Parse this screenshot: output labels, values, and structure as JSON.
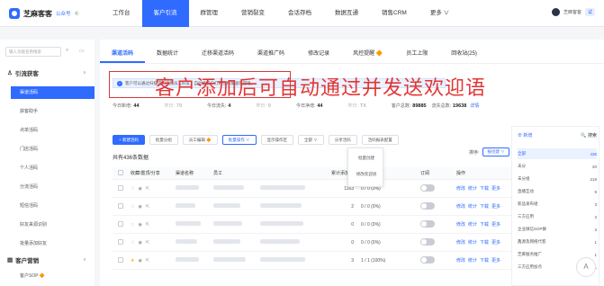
{
  "header": {
    "brand": "芝麻客客",
    "brand_sub": "公众号",
    "brand_extra": "⑥",
    "nav": [
      "工作台",
      "客户引流",
      "群管理",
      "营销裂变",
      "会话存档",
      "数据互通",
      "销售CRM",
      "更多 ∨"
    ],
    "user_name": "芝麻客客",
    "user_tag": "试"
  },
  "sidebar": {
    "search_placeholder": "输入功能名称搜索",
    "group1": "引流获客",
    "items1": [
      "渠道活码",
      "获客助手",
      "点单活码",
      "门店活码",
      "个人活码",
      "分流活码",
      "短信活码",
      "好友来源识别",
      "批量添加好友",
      "批量添加好友"
    ],
    "group2": "客户营销",
    "items2": [
      "客户SOP 🔶"
    ]
  },
  "tabs": [
    "渠道活码",
    "数据统计",
    "迁移渠道活码",
    "渠道推广码",
    "修改记录",
    "风控提醒 🔶",
    "员工上限",
    "回收站(25)"
  ],
  "notice": "客户可以通过扫描活码添加员工好友，自动给客户打标签和发送欢迎语。",
  "stats": [
    {
      "label": "今日新增:",
      "value": "44"
    },
    {
      "label": "昨日:",
      "value": "79"
    },
    {
      "label": "今日流失:",
      "value": "4"
    },
    {
      "label": "昨日:",
      "value": "9"
    },
    {
      "label": "今日净增:",
      "value": "44"
    },
    {
      "label": "昨日:",
      "value": "TX"
    }
  ],
  "stats_right": {
    "label1": "客户总数:",
    "value1": "89885",
    "label2": "流失总数:",
    "value2": "19638",
    "link": "详情"
  },
  "overlay": "客户添加后可自动通过并发送欢迎语",
  "toolbar": [
    "+ 新建活码",
    "批量分组",
    "员工编辑 🔶",
    "批量操作 ∨",
    "显示操作区",
    "全部 ∨",
    "分享活码",
    "活码报表配置"
  ],
  "dropdown": [
    "批量创建",
    "修改欢迎语"
  ],
  "count": "共有436条数据",
  "sort": {
    "label": "排序:",
    "sel1": "按创建 ∨",
    "sel2": "按人数 ∨"
  },
  "table": {
    "headers": [
      "",
      "收藏/置顶/分享",
      "渠道名称",
      "员工",
      "",
      "累计添加数",
      "新增/留存",
      "订阅",
      "操作"
    ],
    "rows": [
      {
        "count": "1163",
        "new": "0 / 0 (0%)"
      },
      {
        "count": "2",
        "new": "0 / 0 (0%)"
      },
      {
        "count": "0",
        "new": "0 / 0 (0%)"
      },
      {
        "count": "0",
        "new": "0 / 0 (0%)"
      },
      {
        "count": "3",
        "new": "1 / 1 (100%)"
      }
    ],
    "ops": [
      "修改",
      "统计",
      "下载",
      "更多"
    ]
  },
  "rpanel": {
    "title": "⊕ 新增",
    "search": "🔍 搜索",
    "items": [
      {
        "n": "全部",
        "v": "436"
      },
      {
        "n": "未分",
        "v": "20"
      },
      {
        "n": "未分组",
        "v": "219"
      },
      {
        "n": "直播互动",
        "v": "9"
      },
      {
        "n": "新品发布组",
        "v": "3"
      },
      {
        "n": "三方应用",
        "v": "3"
      },
      {
        "n": "企业微信SOP群",
        "v": "3"
      },
      {
        "n": "鑫源及网络代客",
        "v": "1"
      },
      {
        "n": "芝麻服务推广",
        "v": "1"
      },
      {
        "n": "三方应用加点",
        "v": "1"
      }
    ]
  }
}
